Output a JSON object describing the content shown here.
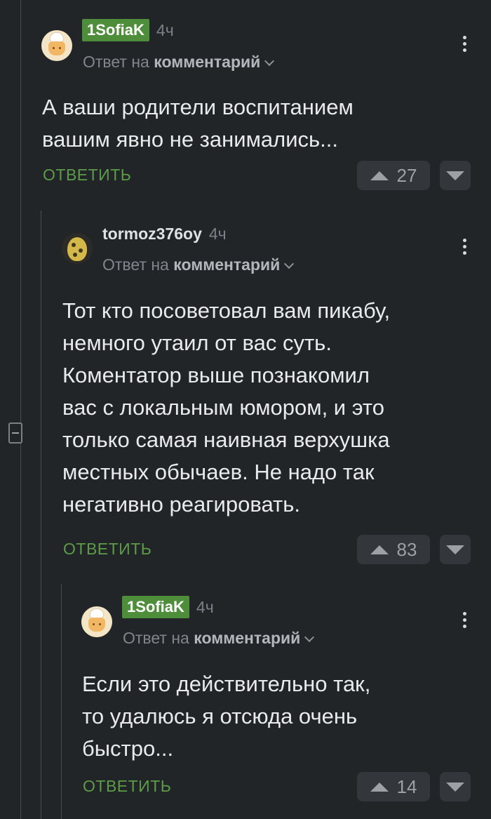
{
  "comments": [
    {
      "author": "1SofiaK",
      "time": "4ч",
      "reply_prefix": "Ответ на",
      "reply_target": "комментарий",
      "text": [
        "А ваши родители воспитанием",
        "вашим явно не занимались..."
      ],
      "reply_label": "ОТВЕТИТЬ",
      "rating": "27"
    },
    {
      "author": "tormoz376oy",
      "time": "4ч",
      "reply_prefix": "Ответ на",
      "reply_target": "комментарий",
      "text": [
        "Тот кто посоветовал вам пикабу,",
        "немного утаил от вас суть.",
        "Коментатор выше познакомил",
        "вас с локальным юмором, и это",
        "только самая наивная верхушка",
        "местных обычаев. Не надо так",
        "негативно реагировать."
      ],
      "reply_label": "ОТВЕТИТЬ",
      "rating": "83"
    },
    {
      "author": "1SofiaK",
      "time": "4ч",
      "reply_prefix": "Ответ на",
      "reply_target": "комментарий",
      "text": [
        "Если это действительно так,",
        "то удалюсь я отсюда очень",
        "быстро..."
      ],
      "reply_label": "ОТВЕТИТЬ",
      "rating": "14"
    }
  ],
  "colors": {
    "background": "#222528",
    "badge": "#4e8d3a",
    "reply_link": "#5c9b47"
  }
}
